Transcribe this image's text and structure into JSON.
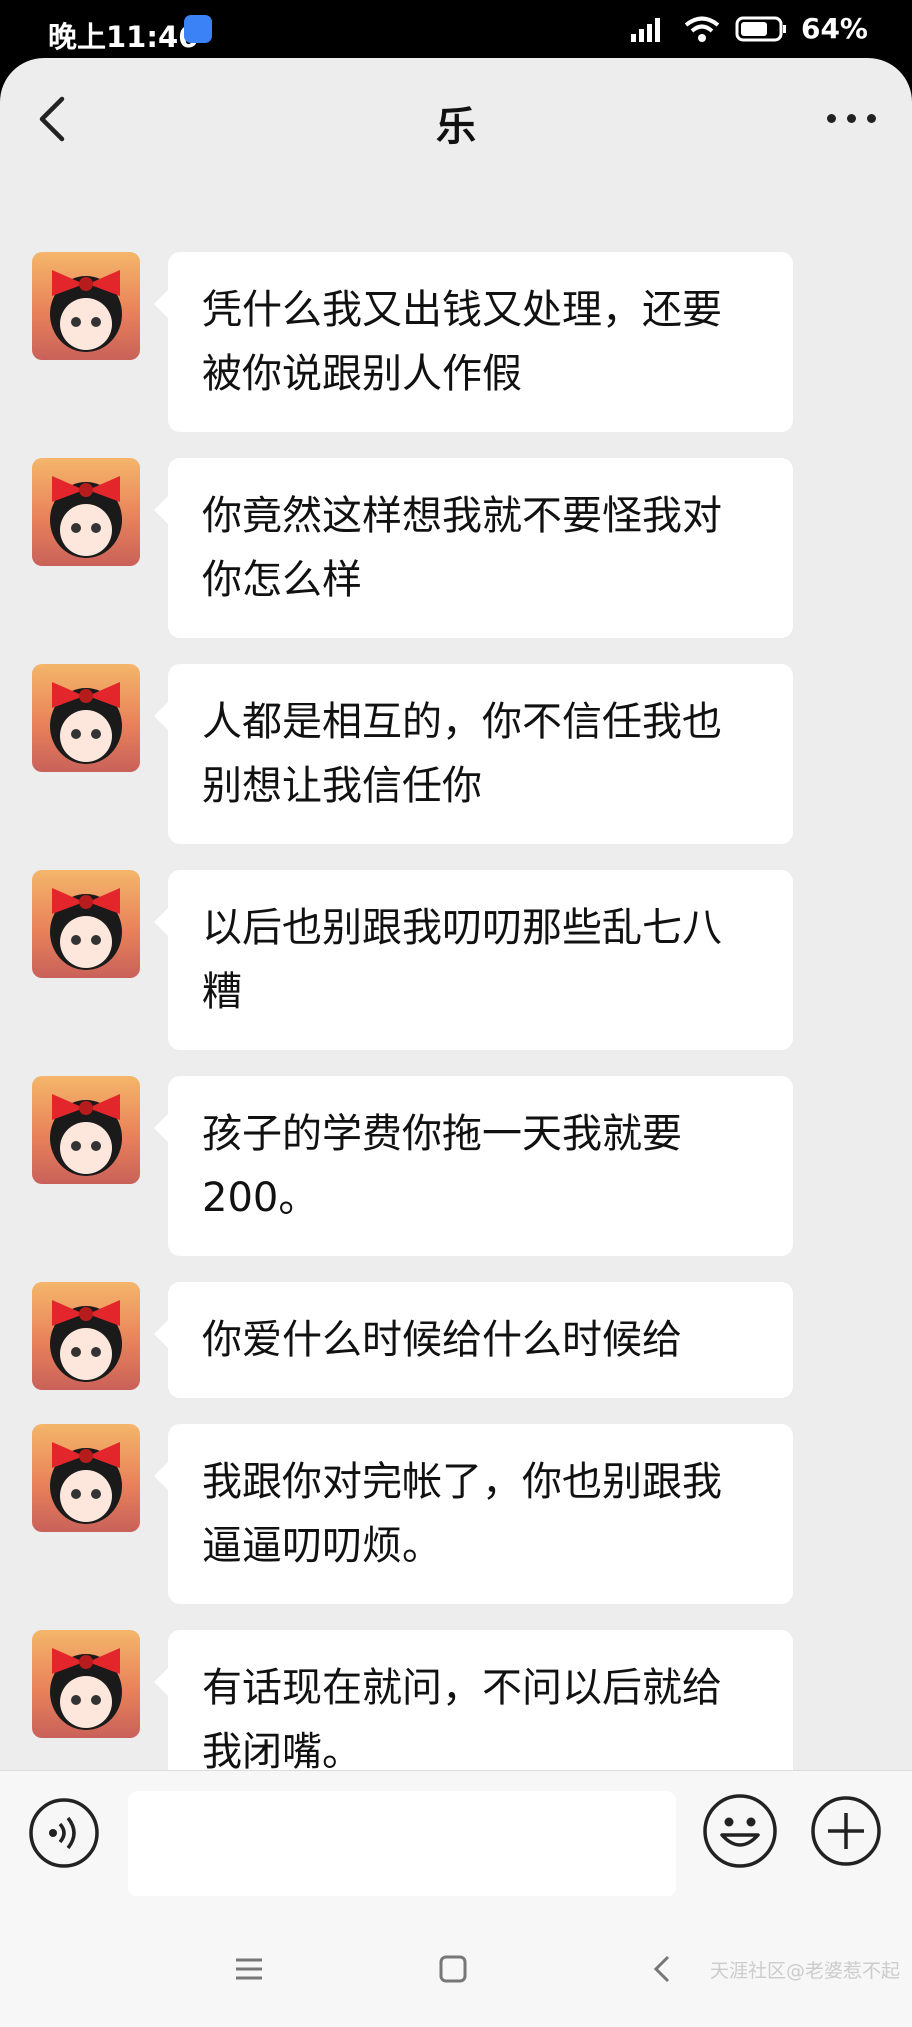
{
  "status_bar": {
    "time": "晚上11:46",
    "battery": "64%"
  },
  "header": {
    "title": "乐"
  },
  "messages": [
    {
      "text": "凭什么我又出钱又处理，还要被你说跟别人作假"
    },
    {
      "text": "你竟然这样想我就不要怪我对你怎么样"
    },
    {
      "text": "人都是相互的，你不信任我也别想让我信任你"
    },
    {
      "text": "以后也别跟我叨叨那些乱七八糟"
    },
    {
      "text": "孩子的学费你拖一天我就要200。"
    },
    {
      "text": "你爱什么时候给什么时候给"
    },
    {
      "text": "我跟你对完帐了，你也别跟我逼逼叨叨烦。"
    },
    {
      "text": "有话现在就问，不问以后就给我闭嘴。"
    }
  ],
  "watermark": "天涯社区@老婆惹不起"
}
